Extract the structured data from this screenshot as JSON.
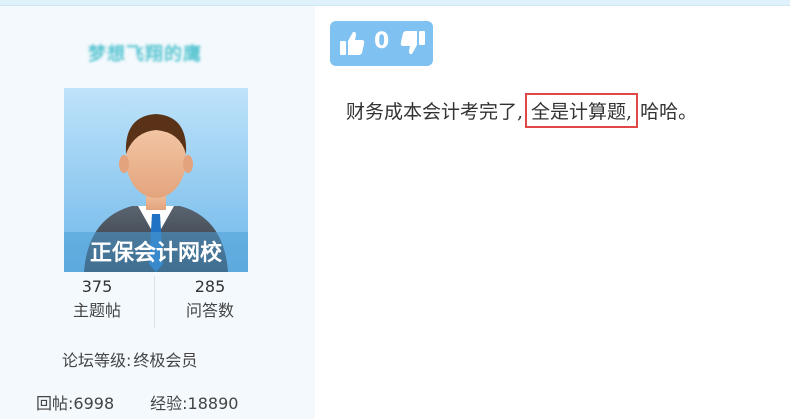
{
  "user": {
    "name": "梦想飞翔的鹰",
    "avatar_watermark": "正保会计网校",
    "stats": [
      {
        "value": "375",
        "label": "主题帖"
      },
      {
        "value": "285",
        "label": "问答数"
      }
    ],
    "level_label": "论坛等级:",
    "level_value": "终极会员",
    "replies_label": "回帖:",
    "replies_value": "6998",
    "exp_label": "经验:",
    "exp_value": "18890"
  },
  "post": {
    "vote_count": "0",
    "text_before": "财务成本会计考完了,",
    "text_highlight": "全是计算题,",
    "text_after": "哈哈。"
  },
  "colors": {
    "vote_bg": "#7fc1f0",
    "highlight_border": "#e04848",
    "username": "#5cc6d2"
  },
  "icons": [
    "thumbs-up-icon",
    "thumbs-down-icon"
  ]
}
